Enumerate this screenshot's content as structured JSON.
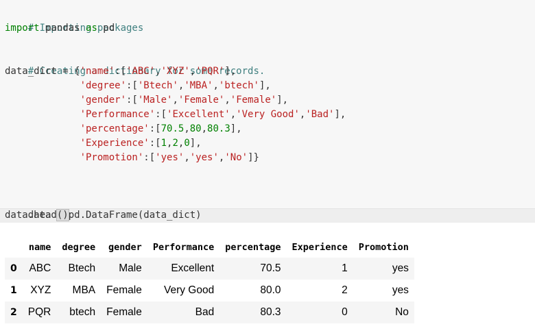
{
  "code": {
    "comment1": "# Importing packages",
    "import_kw": "import",
    "import_rest": " pandas ",
    "as_kw": "as",
    "import_alias": " pd",
    "comment2": "# Creating a dictionary for some records.",
    "dict_lines": [
      {
        "prefix": "data_dict = {",
        "key": "'name'",
        "sep": ":[",
        "items": [
          "'ABC'",
          "'XYZ'",
          "'PQR'"
        ],
        "items_type": "str",
        "suffix": "],"
      },
      {
        "prefix": "             ",
        "key": "'degree'",
        "sep": ":[",
        "items": [
          "'Btech'",
          "'MBA'",
          "'btech'"
        ],
        "items_type": "str",
        "suffix": "],"
      },
      {
        "prefix": "             ",
        "key": "'gender'",
        "sep": ":[",
        "items": [
          "'Male'",
          "'Female'",
          "'Female'"
        ],
        "items_type": "str",
        "suffix": "],"
      },
      {
        "prefix": "             ",
        "key": "'Performance'",
        "sep": ":[",
        "items": [
          "'Excellent'",
          "'Very Good'",
          "'Bad'"
        ],
        "items_type": "str",
        "suffix": "],"
      },
      {
        "prefix": "             ",
        "key": "'percentage'",
        "sep": ":[",
        "items": [
          "70.5",
          "80",
          "80.3"
        ],
        "items_type": "num",
        "suffix": "],"
      },
      {
        "prefix": "             ",
        "key": "'Experience'",
        "sep": ":[",
        "items": [
          "1",
          "2",
          "0"
        ],
        "items_type": "num",
        "suffix": "],"
      },
      {
        "prefix": "             ",
        "key": "'Promotion'",
        "sep": ":[",
        "items": [
          "'yes'",
          "'yes'",
          "'No'"
        ],
        "items_type": "str",
        "suffix": "]}"
      }
    ],
    "line_dataframe": "data = pd.DataFrame(data_dict)",
    "line_head_prefix": "data.head",
    "line_head_parens": "()"
  },
  "dataframe": {
    "columns": [
      "",
      "name",
      "degree",
      "gender",
      "Performance",
      "percentage",
      "Experience",
      "Promotion"
    ],
    "rows": [
      [
        "0",
        "ABC",
        "Btech",
        "Male",
        "Excellent",
        "70.5",
        "1",
        "yes"
      ],
      [
        "1",
        "XYZ",
        "MBA",
        "Female",
        "Very Good",
        "80.0",
        "2",
        "yes"
      ],
      [
        "2",
        "PQR",
        "btech",
        "Female",
        "Bad",
        "80.3",
        "0",
        "No"
      ]
    ]
  }
}
